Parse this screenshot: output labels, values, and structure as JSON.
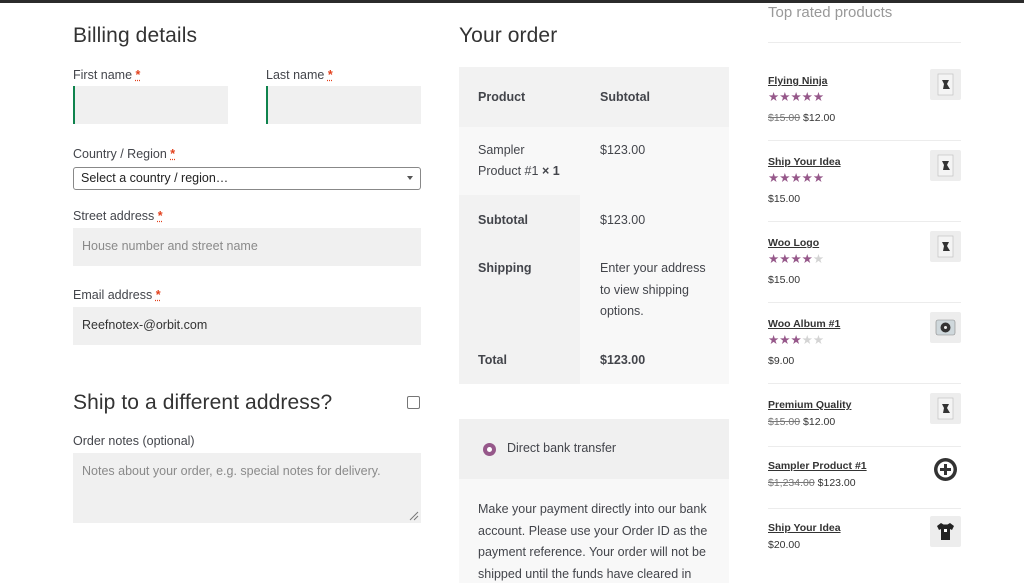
{
  "billing": {
    "title": "Billing details",
    "first_name_label": "First name",
    "last_name_label": "Last name",
    "country_label": "Country / Region",
    "country_value": "Select a country / region…",
    "street_label": "Street address",
    "street_placeholder": "House number and street name",
    "email_label": "Email address",
    "email_value": "Reefnotex-@orbit.com",
    "ship_diff_label": "Ship to a different address?",
    "notes_label": "Order notes (optional)",
    "notes_placeholder": "Notes about your order, e.g. special notes for delivery.",
    "required_mark": "*"
  },
  "order": {
    "title": "Your order",
    "col_product": "Product",
    "col_subtotal": "Subtotal",
    "item_name_line1": "Sampler",
    "item_name_line2": "Product #1",
    "item_qty": "× 1",
    "item_total": "$123.00",
    "subtotal_label": "Subtotal",
    "subtotal_value": "$123.00",
    "shipping_label": "Shipping",
    "shipping_line1": "Enter your address",
    "shipping_line2": "to view shipping",
    "shipping_line3": "options.",
    "total_label": "Total",
    "total_value": "$123.00"
  },
  "payment": {
    "method_label": "Direct bank transfer",
    "desc_line1": "Make your payment directly into our bank",
    "desc_line2": "account. Please use your Order ID as the",
    "desc_line3": "payment reference. Your order will not be",
    "desc_line4": "shipped until the funds have cleared in"
  },
  "sidebar": {
    "title": "Top rated products",
    "products": [
      {
        "name": "Flying Ninja",
        "rating": 5,
        "old_price": "$15.00",
        "price": "$12.00",
        "icon": "poster-icon"
      },
      {
        "name": "Ship Your Idea",
        "rating": 5,
        "old_price": "",
        "price": "$15.00",
        "icon": "poster-icon"
      },
      {
        "name": "Woo Logo",
        "rating": 4,
        "old_price": "",
        "price": "$15.00",
        "icon": "poster-icon"
      },
      {
        "name": "Woo Album #1",
        "rating": 3,
        "old_price": "",
        "price": "$9.00",
        "icon": "album-icon"
      },
      {
        "name": "Premium Quality",
        "rating": 0,
        "old_price": "$15.00",
        "price": "$12.00",
        "icon": "poster-icon"
      },
      {
        "name": "Sampler Product #1",
        "rating": 0,
        "old_price": "$1,234.00",
        "price": "$123.00",
        "icon": "plus-circle-icon"
      },
      {
        "name": "Ship Your Idea",
        "rating": 0,
        "old_price": "",
        "price": "$20.00",
        "icon": "tshirt-icon"
      }
    ]
  },
  "colors": {
    "accent": "#96588a",
    "required": "#e2401c",
    "valid_border": "#0f834d"
  }
}
